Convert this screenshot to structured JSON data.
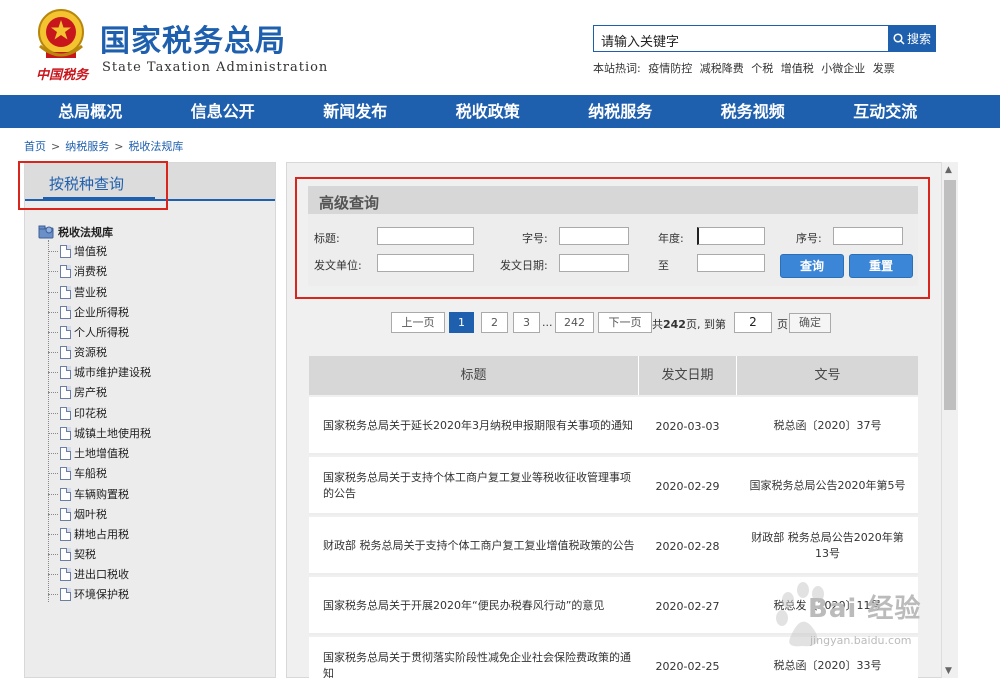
{
  "header": {
    "title": "国家税务总局",
    "subtitle": "State Taxation Administration",
    "brand_script": "中国税务",
    "search_placeholder": "请输入关键字",
    "search_button": "搜索",
    "hotwords_label": "本站热词:",
    "hotwords": [
      "疫情防控",
      "减税降费",
      "个税",
      "增值税",
      "小微企业",
      "发票"
    ]
  },
  "nav": [
    "总局概况",
    "信息公开",
    "新闻发布",
    "税收政策",
    "纳税服务",
    "税务视频",
    "互动交流"
  ],
  "breadcrumb": [
    "首页",
    "纳税服务",
    "税收法规库"
  ],
  "sidebar": {
    "tab": "按税种查询",
    "tree_root": "税收法规库",
    "items": [
      "增值税",
      "消费税",
      "营业税",
      "企业所得税",
      "个人所得税",
      "资源税",
      "城市维护建设税",
      "房产税",
      "印花税",
      "城镇土地使用税",
      "土地增值税",
      "车船税",
      "车辆购置税",
      "烟叶税",
      "耕地占用税",
      "契税",
      "进出口税收",
      "环境保护税"
    ]
  },
  "query": {
    "title": "高级查询",
    "labels": {
      "title": "标题:",
      "zihao": "字号:",
      "niandu": "年度:",
      "xuhao": "序号:",
      "unit": "发文单位:",
      "date": "发文日期:",
      "to": "至"
    },
    "search_button": "查询",
    "reset_button": "重置"
  },
  "pagination": {
    "prev": "上一页",
    "pages": [
      "1",
      "2",
      "3"
    ],
    "ellipsis": "...",
    "last": "242",
    "next": "下一页",
    "total_prefix": "共",
    "total": "242",
    "total_suffix": "页, 到第",
    "goto_value": "2",
    "page_unit": "页",
    "confirm": "确定"
  },
  "table": {
    "headers": [
      "标题",
      "发文日期",
      "文号"
    ],
    "rows": [
      {
        "title": "国家税务总局关于延长2020年3月纳税申报期限有关事项的通知",
        "date": "2020-03-03",
        "docno": "税总函〔2020〕37号"
      },
      {
        "title": "国家税务总局关于支持个体工商户复工复业等税收征收管理事项的公告",
        "date": "2020-02-29",
        "docno": "国家税务总局公告2020年第5号"
      },
      {
        "title": "财政部 税务总局关于支持个体工商户复工复业增值税政策的公告",
        "date": "2020-02-28",
        "docno": "财政部 税务总局公告2020年第13号"
      },
      {
        "title": "国家税务总局关于开展2020年“便民办税春风行动”的意见",
        "date": "2020-02-27",
        "docno": "税总发〔2020〕11号"
      },
      {
        "title": "国家税务总局关于贯彻落实阶段性减免企业社会保险费政策的通知",
        "date": "2020-02-25",
        "docno": "税总函〔2020〕33号"
      }
    ]
  },
  "watermark": {
    "text": "Bai 经验",
    "sub": "jingyan.baidu.com"
  },
  "colors": {
    "brand_blue": "#1e5fae",
    "highlight_red": "#d9261c",
    "button_blue": "#3b86d6"
  }
}
